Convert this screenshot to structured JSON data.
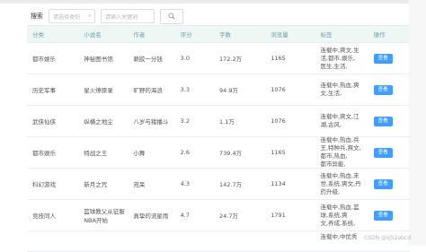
{
  "search": {
    "label": "搜索",
    "select_placeholder": "请选择类别",
    "input_placeholder": "请输入关键词"
  },
  "table": {
    "headers": [
      "分类",
      "小说名",
      "作者",
      "评分",
      "字数",
      "浏览量",
      "标签",
      "操作"
    ],
    "rows": [
      {
        "category": "都市娱乐",
        "title": "神秘图书馆",
        "author": "赖胶一分钱",
        "score": "3.0",
        "words": "172.2万",
        "views": "1165",
        "tags": [
          "连载中,爽文,生",
          "活,都市,娱乐,",
          "医生,生活,"
        ],
        "action": "查看"
      },
      {
        "category": "历史军事",
        "title": "星火燎原录",
        "author": "旷野的海浪",
        "score": "3.3",
        "words": "94.9万",
        "views": "1076",
        "tags": [
          "连载中,热血,爽",
          "文,生活,"
        ],
        "action": "查看"
      },
      {
        "category": "武侠仙侠",
        "title": "纵横之地尘",
        "author": "八岁与猪播斗",
        "score": "3.2",
        "words": "1.1万",
        "views": "1076",
        "tags": [
          "连载中,爽文,江",
          "湖,古风,"
        ],
        "action": "查看"
      },
      {
        "category": "都市娱乐",
        "title": "特战之王",
        "author": "小舞",
        "score": "2.6",
        "words": "739.4万",
        "views": "1165",
        "tags": [
          "连载中,热血,兵",
          "王,特种兵,爽文,",
          "都市,热血,",
          "都市异能,"
        ],
        "action": "查看"
      },
      {
        "category": "科幻游戏",
        "title": "新月之咒",
        "author": "宛呆",
        "score": "4.3",
        "words": "142.7万",
        "views": "1134",
        "tags": [
          "连载中,热血,末",
          "世,系统,爽文,丹",
          "药升级,"
        ],
        "action": "查看"
      },
      {
        "category": "竞技同人",
        "title": "篮球教父从征服NBA开始",
        "author": "真挚的流星雨",
        "score": "4.7",
        "words": "24.7万",
        "views": "1791",
        "tags": [
          "连载中,热血,篮",
          "球,系统,爽",
          "文,养成,系统,"
        ],
        "action": "查看"
      }
    ],
    "partial_row": {
      "tags": [
        "连载中,中优秀"
      ]
    }
  },
  "watermark": "CSDN @sj52abcd"
}
